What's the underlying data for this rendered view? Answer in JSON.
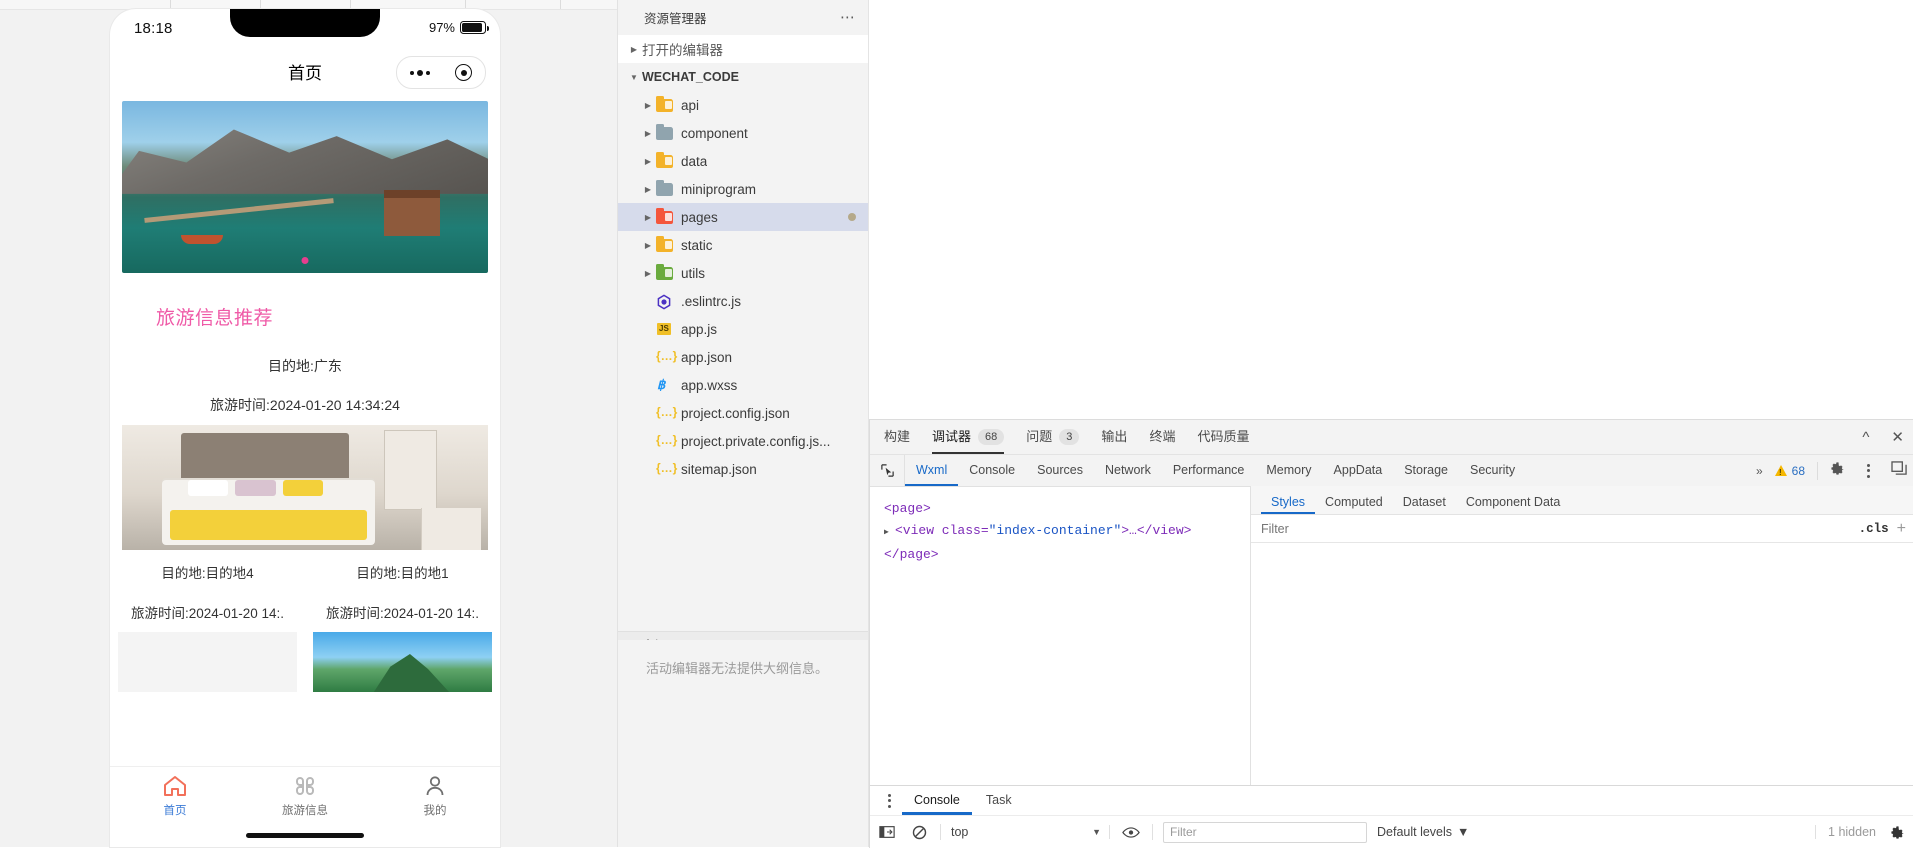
{
  "simulator": {
    "status_bar": {
      "time": "18:18",
      "battery_percent": "97%"
    },
    "nav": {
      "title": "首页",
      "capsule_menu_icon": "more-dots-icon",
      "capsule_target_icon": "target-circle-icon"
    },
    "section_title": "旅游信息推荐",
    "featured": {
      "destination": "目的地:广东",
      "travel_time": "旅游时间:2024-01-20 14:34:24"
    },
    "cards": [
      {
        "destination": "目的地:目的地4",
        "travel_time": "旅游时间:2024-01-20 14:."
      },
      {
        "destination": "目的地:目的地1",
        "travel_time": "旅游时间:2024-01-20 14:."
      }
    ],
    "tabbar": [
      {
        "label": "首页",
        "icon": "home-icon",
        "active": true
      },
      {
        "label": "旅游信息",
        "icon": "grid-clover-icon",
        "active": false
      },
      {
        "label": "我的",
        "icon": "user-icon",
        "active": false
      }
    ]
  },
  "explorer": {
    "title": "资源管理器",
    "more_icon": "ellipsis-icon",
    "open_editors": "打开的编辑器",
    "project_root": "WECHAT_CODE",
    "tree": [
      {
        "name": "api",
        "type": "folder",
        "color": "#f3b229",
        "tag": true
      },
      {
        "name": "component",
        "type": "folder",
        "color": "#90a4ae",
        "tag": false
      },
      {
        "name": "data",
        "type": "folder",
        "color": "#f3b229",
        "tag": true
      },
      {
        "name": "miniprogram",
        "type": "folder",
        "color": "#90a4ae",
        "tag": false
      },
      {
        "name": "pages",
        "type": "folder",
        "color": "#f4563c",
        "tag": true,
        "selected": true,
        "dirty": true
      },
      {
        "name": "static",
        "type": "folder",
        "color": "#f3b229",
        "tag": true
      },
      {
        "name": "utils",
        "type": "folder",
        "color": "#6aab3e",
        "tag": true
      },
      {
        "name": ".eslintrc.js",
        "type": "file",
        "icon": "eslint-icon",
        "color": "#4b32c3"
      },
      {
        "name": "app.js",
        "type": "file",
        "icon": "js-icon",
        "color": "#f0bf26"
      },
      {
        "name": "app.json",
        "type": "file",
        "icon": "json-icon",
        "color": "#f0bf26"
      },
      {
        "name": "app.wxss",
        "type": "file",
        "icon": "css-icon",
        "color": "#2196f3"
      },
      {
        "name": "project.config.json",
        "type": "file",
        "icon": "json-icon",
        "color": "#f0bf26"
      },
      {
        "name": "project.private.config.js...",
        "type": "file",
        "icon": "json-icon",
        "color": "#f0bf26"
      },
      {
        "name": "sitemap.json",
        "type": "file",
        "icon": "json-icon",
        "color": "#f0bf26"
      }
    ],
    "outline": {
      "title": "大纲",
      "empty_message": "活动编辑器无法提供大纲信息。"
    }
  },
  "devtools": {
    "panel_tabs": [
      {
        "label": "构建",
        "badge": null,
        "active": false
      },
      {
        "label": "调试器",
        "badge": "68",
        "active": true
      },
      {
        "label": "问题",
        "badge": "3",
        "active": false
      },
      {
        "label": "输出",
        "badge": null,
        "active": false
      },
      {
        "label": "终端",
        "badge": null,
        "active": false
      },
      {
        "label": "代码质量",
        "badge": null,
        "active": false
      }
    ],
    "window_controls": {
      "collapse_icon": "chevron-up-icon",
      "close_icon": "close-icon"
    },
    "inspector_tabs": [
      {
        "label": "Wxml",
        "active": true
      },
      {
        "label": "Console",
        "active": false
      },
      {
        "label": "Sources",
        "active": false
      },
      {
        "label": "Network",
        "active": false
      },
      {
        "label": "Performance",
        "active": false
      },
      {
        "label": "Memory",
        "active": false
      },
      {
        "label": "AppData",
        "active": false
      },
      {
        "label": "Storage",
        "active": false
      },
      {
        "label": "Security",
        "active": false
      }
    ],
    "inspector_overflow": "»",
    "warning_count": "68",
    "right_icons": [
      "gear-icon",
      "kebab-menu-icon",
      "dock-panel-icon"
    ],
    "select_element_icon": "cursor-select-icon",
    "wxml": {
      "line1": "<page>",
      "line2_open": "<view class=",
      "line2_class": "\"index-container\"",
      "line2_rest": ">…</view>",
      "line3": "</page>"
    },
    "styles": {
      "tabs": [
        {
          "label": "Styles",
          "active": true
        },
        {
          "label": "Computed",
          "active": false
        },
        {
          "label": "Dataset",
          "active": false
        },
        {
          "label": "Component Data",
          "active": false
        }
      ],
      "filter_placeholder": "Filter",
      "cls_label": ".cls",
      "add_rule_icon": "plus-icon"
    },
    "drawer": {
      "kebab_icon": "kebab-menu-icon",
      "tabs": [
        {
          "label": "Console",
          "active": true
        },
        {
          "label": "Task",
          "active": false
        }
      ],
      "sidebar_toggle_icon": "show-sidebar-icon",
      "clear_icon": "clear-console-icon",
      "context": "top",
      "context_caret_icon": "caret-down-icon",
      "eye_icon": "live-expression-icon",
      "filter_placeholder": "Filter",
      "levels_label": "Default levels",
      "levels_caret_icon": "caret-down-icon",
      "hidden_label": "1 hidden",
      "settings_icon": "gear-icon"
    }
  }
}
